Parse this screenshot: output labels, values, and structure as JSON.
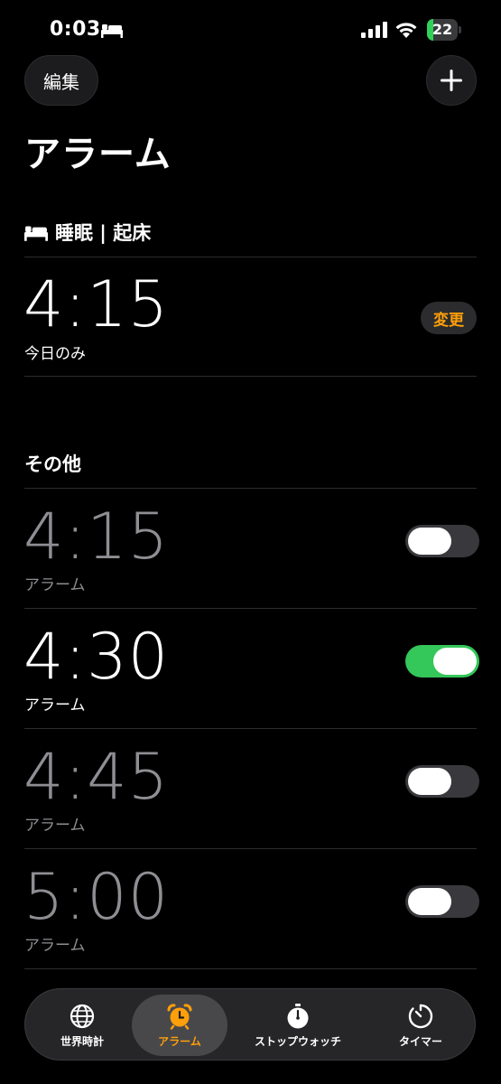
{
  "status_bar": {
    "time": "0:03",
    "battery": "22",
    "battery_level": 0.22
  },
  "header": {
    "edit_label": "編集",
    "title": "アラーム"
  },
  "sleep_section": {
    "title": "睡眠 | 起床",
    "time": "4:15",
    "subtitle": "今日のみ",
    "change_label": "変更"
  },
  "other_section": {
    "title": "その他"
  },
  "alarms": [
    {
      "time": "4:15",
      "label": "アラーム",
      "enabled": false
    },
    {
      "time": "4:30",
      "label": "アラーム",
      "enabled": true
    },
    {
      "time": "4:45",
      "label": "アラーム",
      "enabled": false
    },
    {
      "time": "5:00",
      "label": "アラーム",
      "enabled": false
    }
  ],
  "tabs": [
    {
      "label": "世界時計",
      "icon": "globe-icon",
      "active": false
    },
    {
      "label": "アラーム",
      "icon": "alarm-clock-icon",
      "active": true
    },
    {
      "label": "ストップウォッチ",
      "icon": "stopwatch-icon",
      "active": false
    },
    {
      "label": "タイマー",
      "icon": "timer-icon",
      "active": false
    }
  ],
  "colors": {
    "accent": "#ff9f0a",
    "toggle_on": "#34c759",
    "battery": "#30d158"
  }
}
